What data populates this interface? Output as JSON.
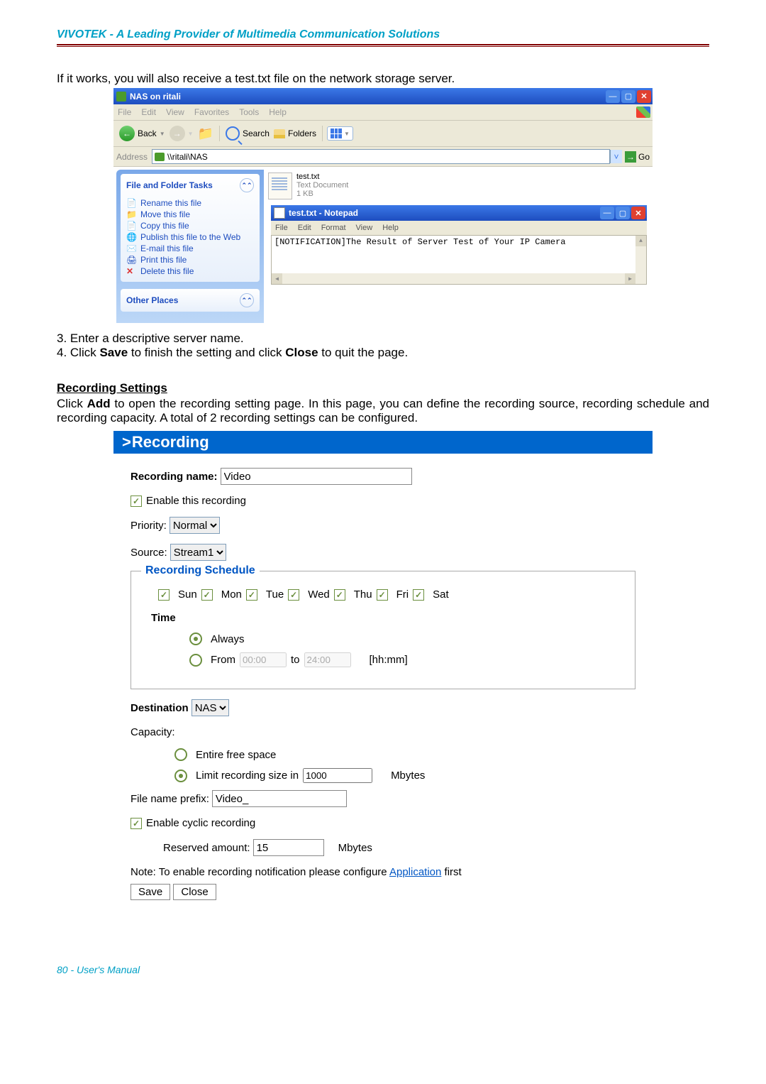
{
  "header": {
    "company_tagline": "VIVOTEK - A Leading Provider of Multimedia Communication Solutions"
  },
  "intro_text": "If it works, you will also receive a test.txt file on the network storage server.",
  "explorer": {
    "title": "NAS on ritali",
    "menu": [
      "File",
      "Edit",
      "View",
      "Favorites",
      "Tools",
      "Help"
    ],
    "back": "Back",
    "search": "Search",
    "folders": "Folders",
    "address_label": "Address",
    "address_value": "\\\\ritali\\NAS",
    "go": "Go",
    "task_panel": {
      "header": "File and Folder Tasks",
      "items": [
        "Rename this file",
        "Move this file",
        "Copy this file",
        "Publish this file to the Web",
        "E-mail this file",
        "Print this file",
        "Delete this file"
      ],
      "other_header": "Other Places"
    },
    "file": {
      "name": "test.txt",
      "kind": "Text Document",
      "size": "1 KB"
    }
  },
  "notepad": {
    "title": "test.txt - Notepad",
    "menu": [
      "File",
      "Edit",
      "Format",
      "View",
      "Help"
    ],
    "content": "[NOTIFICATION]The Result of Server Test of Your IP Camera"
  },
  "steps": {
    "s3": "3. Enter a descriptive server name.",
    "s4_pre": "4. Click ",
    "s4_save": "Save",
    "s4_mid": " to finish the setting and click ",
    "s4_close": "Close",
    "s4_post": " to quit the page."
  },
  "recording_section": {
    "heading": "Recording Settings",
    "desc_pre": "Click ",
    "desc_add": "Add",
    "desc_post": " to open the recording setting page. In this page, you can define the recording source, recording schedule and recording capacity. A total of 2 recording settings can be configured.",
    "panel_title": "Recording"
  },
  "form": {
    "recording_name_label": "Recording name:",
    "recording_name_value": "Video",
    "enable_recording": "Enable this recording",
    "priority_label": "Priority:",
    "priority_value": "Normal",
    "source_label": "Source:",
    "source_value": "Stream1",
    "schedule_legend": "Recording Schedule",
    "days": [
      "Sun",
      "Mon",
      "Tue",
      "Wed",
      "Thu",
      "Fri",
      "Sat"
    ],
    "time_label": "Time",
    "always": "Always",
    "from": "From",
    "from_value": "00:00",
    "to": "to",
    "to_value": "24:00",
    "hhmm": "[hh:mm]",
    "destination_label": "Destination",
    "destination_value": "NAS",
    "capacity_label": "Capacity:",
    "entire_free": "Entire free space",
    "limit_label": "Limit recording size in",
    "limit_value": "1000",
    "mbytes": "Mbytes",
    "prefix_label": "File name prefix:",
    "prefix_value": "Video_",
    "cyclic": "Enable cyclic recording",
    "reserved_label": "Reserved amount:",
    "reserved_value": "15",
    "note_pre": "Note: To enable recording notification please configure ",
    "note_link": "Application",
    "note_post": " first",
    "save_btn": "Save",
    "close_btn": "Close"
  },
  "footer": "80 - User's Manual"
}
